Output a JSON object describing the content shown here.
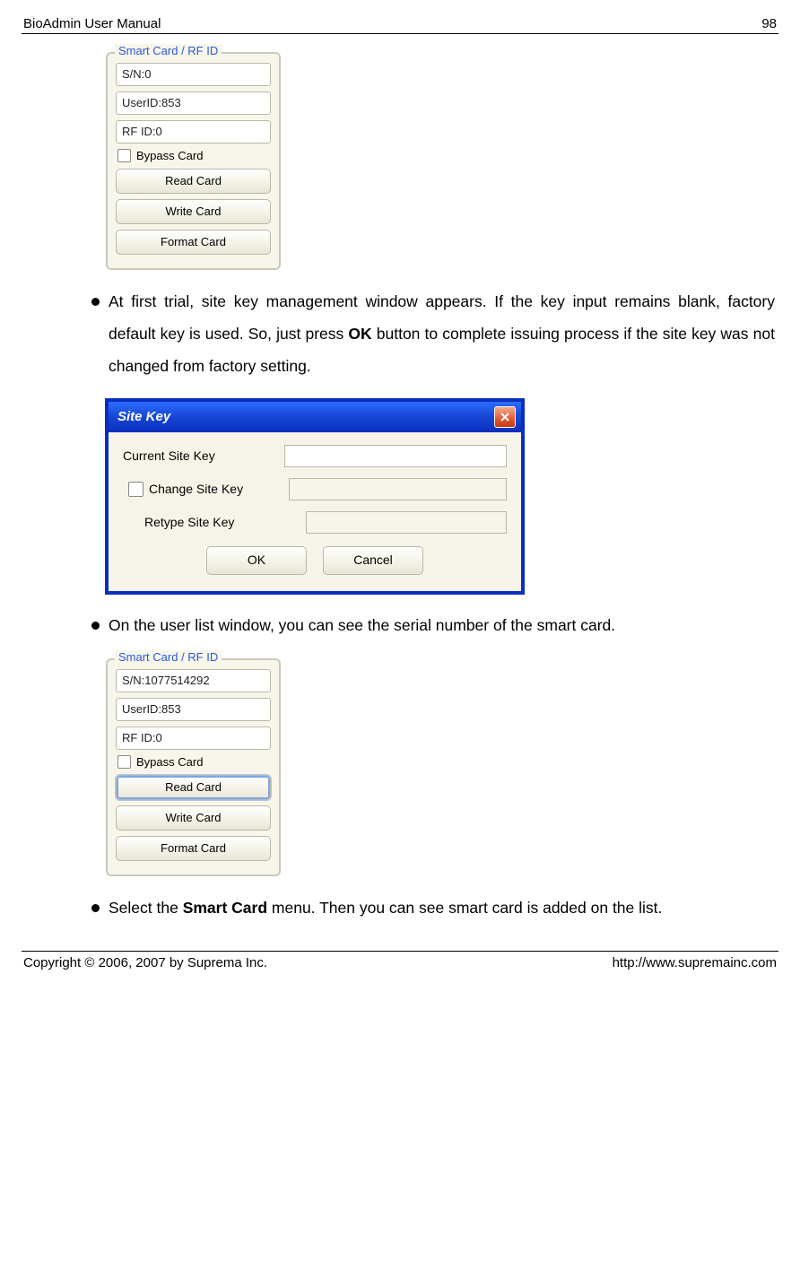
{
  "header": {
    "title": "BioAdmin User Manual",
    "page": "98"
  },
  "panel1": {
    "legend": "Smart Card / RF ID",
    "sn": "S/N:0",
    "userid": "UserID:853",
    "rfid": "RF ID:0",
    "bypass": "Bypass Card",
    "btn_read": "Read Card",
    "btn_write": "Write Card",
    "btn_format": "Format Card"
  },
  "bullet1_pre": "At first trial, site key management window appears. If the key input remains blank, factory default key is used. So, just press ",
  "bullet1_bold": "OK",
  "bullet1_post": " button to complete issuing process if the site key was not changed from factory setting.",
  "dialog": {
    "title": "Site Key",
    "lbl_current": "Current Site Key",
    "lbl_change": "Change Site Key",
    "lbl_retype": "Retype Site Key",
    "btn_ok": "OK",
    "btn_cancel": "Cancel"
  },
  "bullet2": "On the user list window, you can see the serial number of the smart card.",
  "panel2": {
    "legend": "Smart Card / RF ID",
    "sn": "S/N:1077514292",
    "userid": "UserID:853",
    "rfid": "RF ID:0",
    "bypass": "Bypass Card",
    "btn_read": "Read Card",
    "btn_write": "Write Card",
    "btn_format": "Format Card"
  },
  "bullet3_pre": "Select the ",
  "bullet3_bold": "Smart Card",
  "bullet3_post": " menu. Then you can see smart card is added on the list.",
  "footer": {
    "left": "Copyright © 2006, 2007 by Suprema Inc.",
    "right": "http://www.supremainc.com"
  }
}
